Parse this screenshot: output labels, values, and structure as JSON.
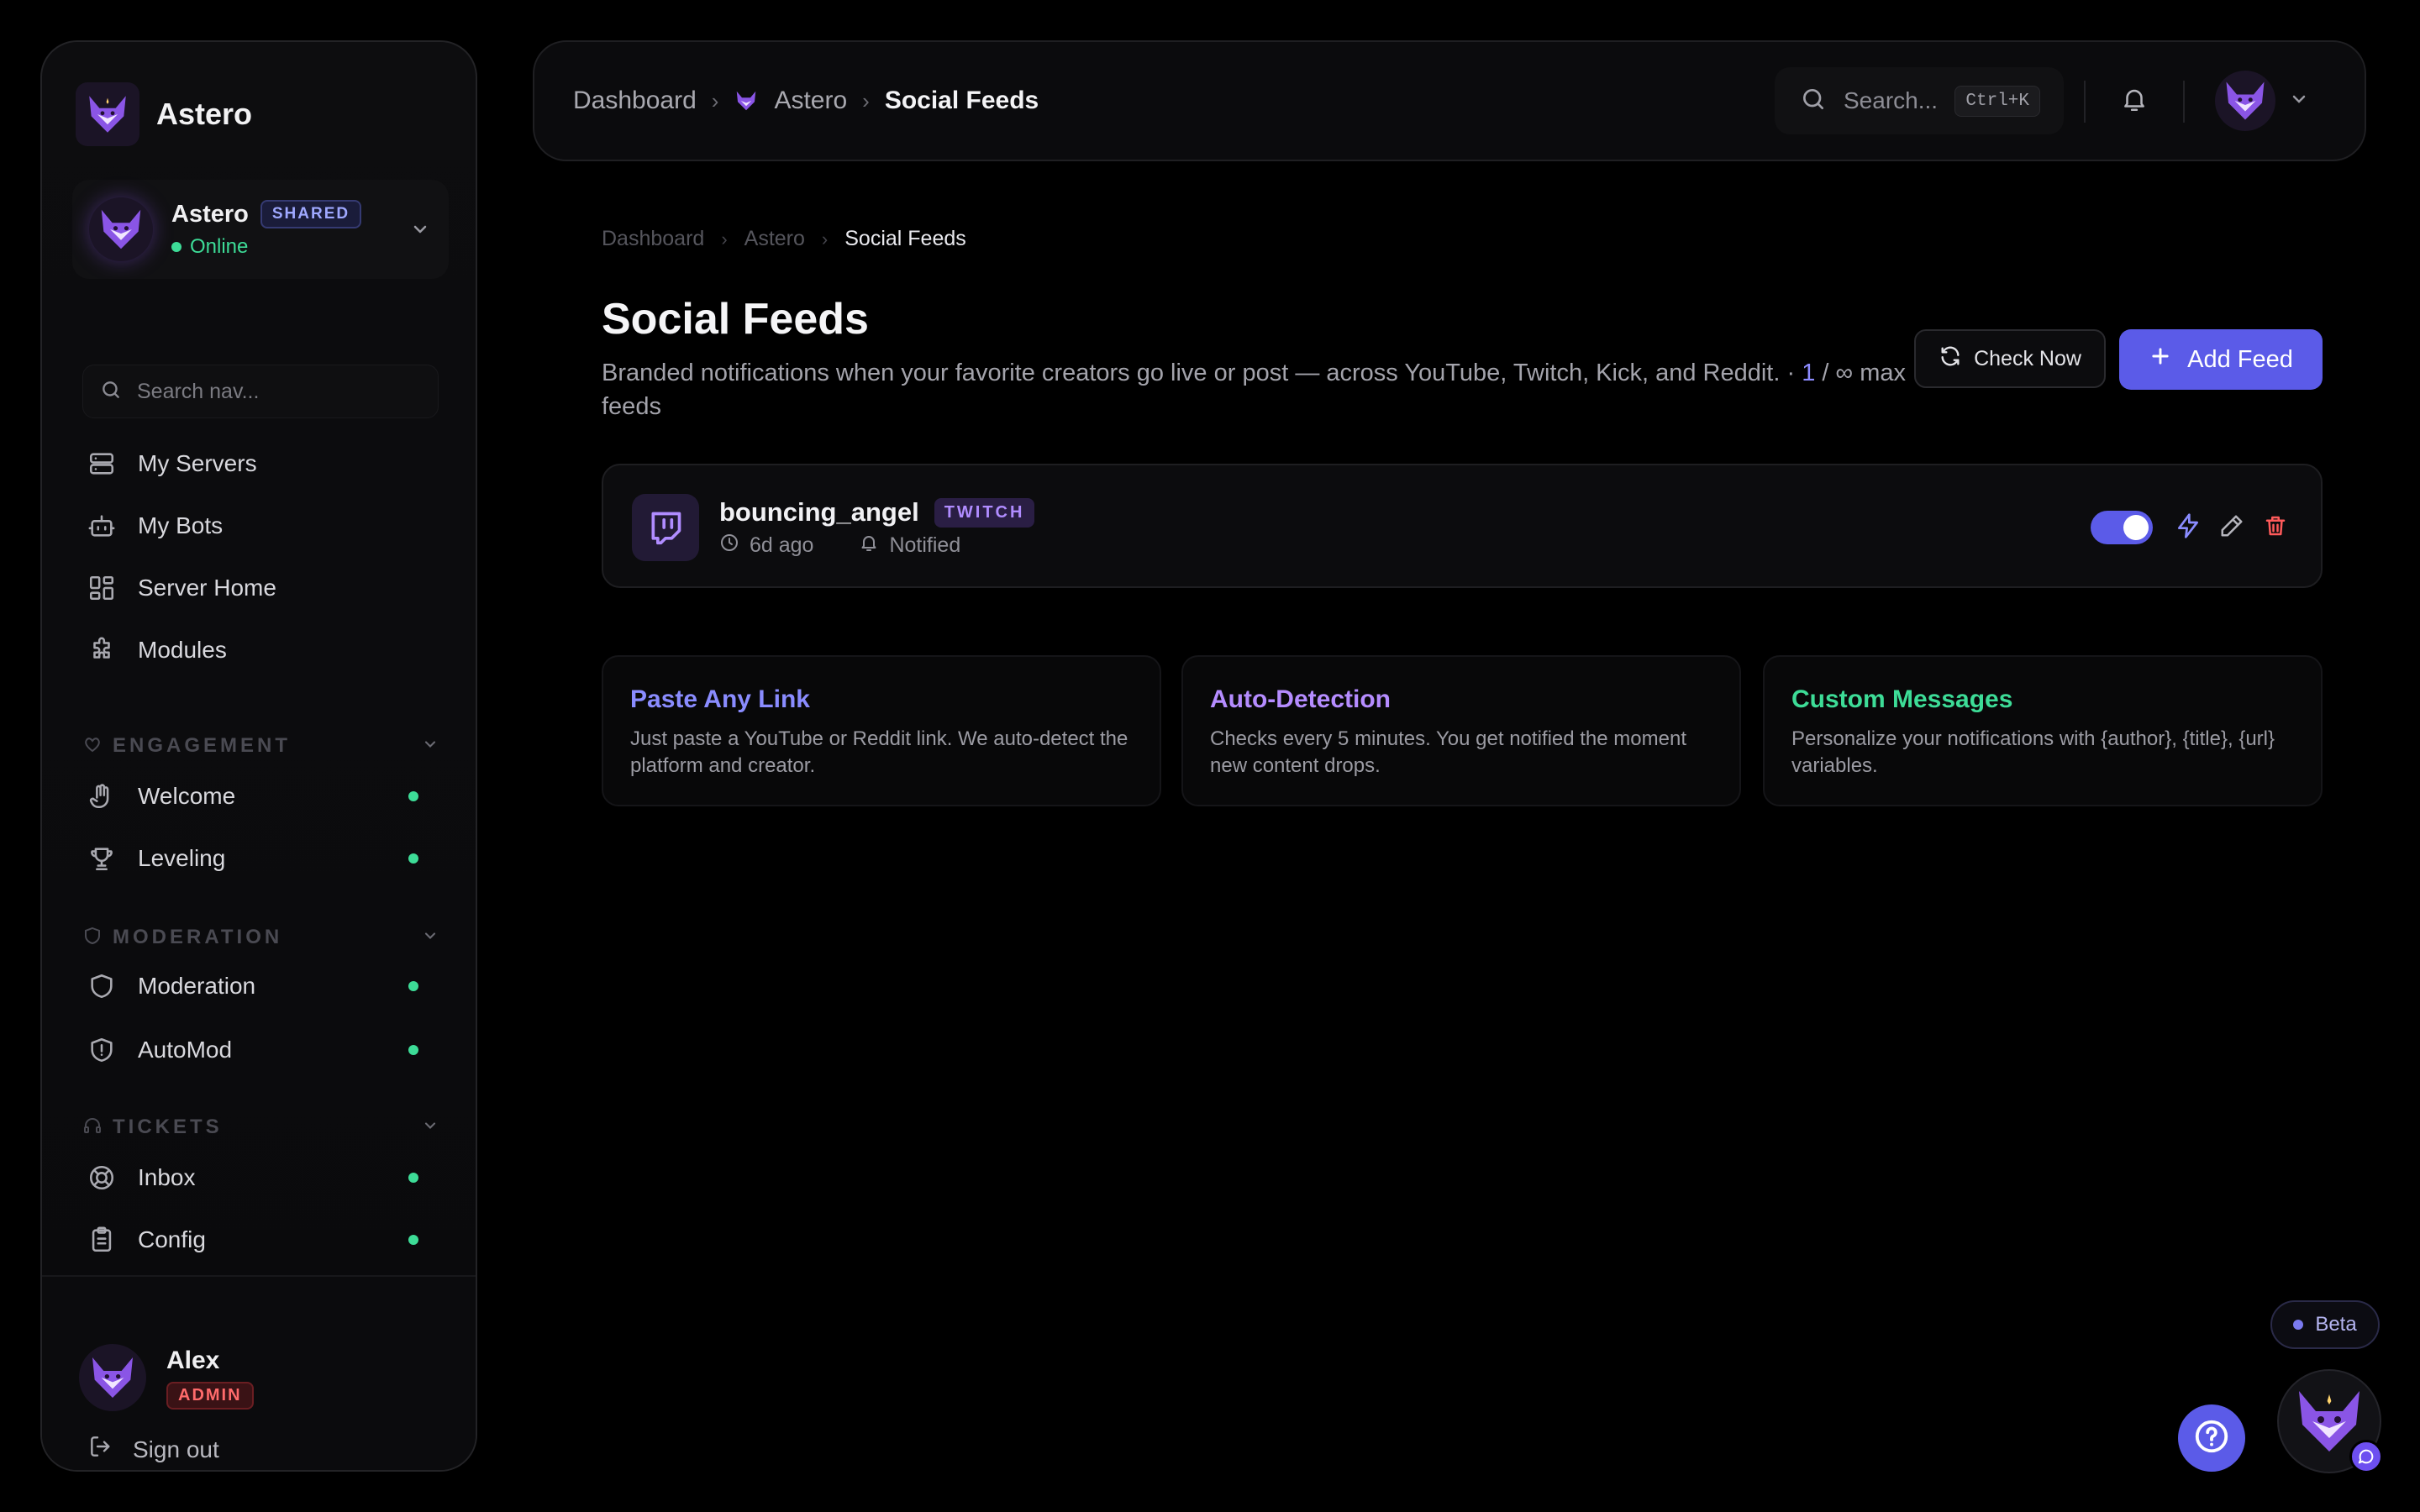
{
  "colors": {
    "accent": "#5b5be8",
    "online": "#3ddc97",
    "danger": "#ff5a5a",
    "twitch": "#b08cff",
    "card_blue": "#8a8cff",
    "card_purple": "#b58cff",
    "card_green": "#3ddc97"
  },
  "sidebar": {
    "brand": "Astero",
    "server": {
      "name": "Astero",
      "badge": "SHARED",
      "status": "Online"
    },
    "search_placeholder": "Search nav...",
    "items": [
      {
        "label": "My Servers",
        "icon": "server-icon"
      },
      {
        "label": "My Bots",
        "icon": "bot-icon"
      },
      {
        "label": "Server Home",
        "icon": "grid-icon"
      },
      {
        "label": "Modules",
        "icon": "puzzle-icon"
      }
    ],
    "sections": [
      {
        "title": "ENGAGEMENT",
        "icon": "heart-icon",
        "items": [
          {
            "label": "Welcome",
            "icon": "hand-icon"
          },
          {
            "label": "Leveling",
            "icon": "trophy-icon"
          }
        ]
      },
      {
        "title": "MODERATION",
        "icon": "shield-icon",
        "items": [
          {
            "label": "Moderation",
            "icon": "shield-icon"
          },
          {
            "label": "AutoMod",
            "icon": "shield-alert-icon"
          }
        ]
      },
      {
        "title": "TICKETS",
        "icon": "headset-icon",
        "items": [
          {
            "label": "Inbox",
            "icon": "lifebuoy-icon"
          },
          {
            "label": "Config",
            "icon": "clipboard-icon"
          }
        ]
      }
    ],
    "user": {
      "name": "Alex",
      "role": "ADMIN"
    },
    "signout": "Sign out"
  },
  "header": {
    "breadcrumbs": [
      "Dashboard",
      "Astero",
      "Social Feeds"
    ],
    "search_placeholder": "Search...",
    "shortcut": "Ctrl+K"
  },
  "main": {
    "breadcrumbs": [
      "Dashboard",
      "Astero",
      "Social Feeds"
    ],
    "title": "Social Feeds",
    "description": "Branded notifications when your favorite creators go live or post — across YouTube, Twitch, Kick, and Reddit. · ",
    "feed_count": "1",
    "feed_max": " / ∞",
    "feed_suffix": " max feeds",
    "check_now": "Check Now",
    "add_feed": "Add Feed",
    "feeds": [
      {
        "name": "bouncing_angel",
        "platform": "TWITCH",
        "time": "6d ago",
        "status": "Notified",
        "enabled": true
      }
    ],
    "info_cards": [
      {
        "title": "Paste Any Link",
        "text": "Just paste a YouTube or Reddit link. We auto-detect the platform and creator."
      },
      {
        "title": "Auto-Detection",
        "text": "Checks every 5 minutes. You get notified the moment new content drops."
      },
      {
        "title": "Custom Messages",
        "text": "Personalize your notifications with {author}, {title}, {url} variables."
      }
    ]
  },
  "floating": {
    "beta": "Beta"
  }
}
